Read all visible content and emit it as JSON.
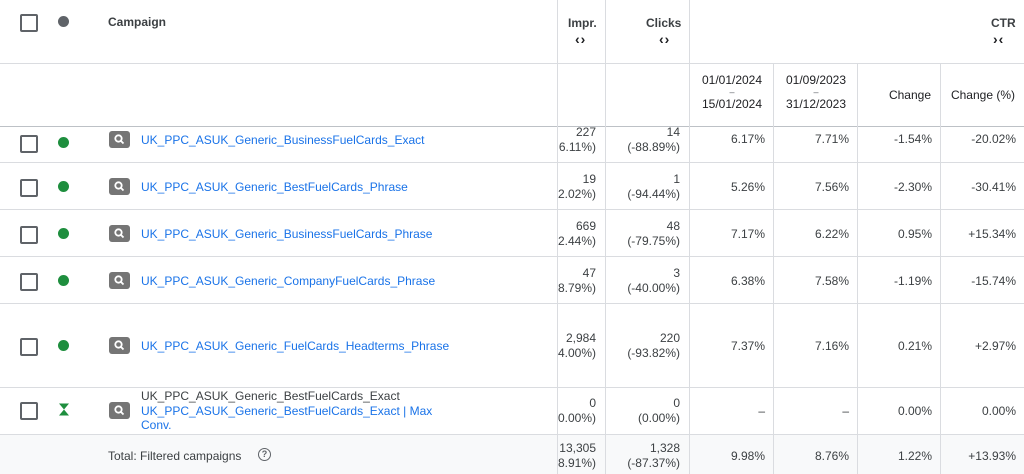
{
  "header": {
    "campaign": "Campaign",
    "impr": "Impr.",
    "clicks": "Clicks",
    "ctr": "CTR",
    "sort_icon": "‹›",
    "expand_icon": "›‹",
    "date_range_1": {
      "start": "01/01/2024",
      "dash": "–",
      "end": "15/01/2024"
    },
    "date_range_2": {
      "start": "01/09/2023",
      "dash": "–",
      "end": "31/12/2023"
    },
    "change": "Change",
    "change_pct": "Change (%)"
  },
  "colors": {
    "status_enabled": "#1e8e3e",
    "link": "#1a73e8",
    "icon_gray": "#757575"
  },
  "rows": [
    {
      "name": "UK_PPC_ASUK_Generic_BusinessFuelCards_Exact",
      "impr": "227",
      "impr_change": "6.11%)",
      "clicks": "14",
      "clicks_change": "(-88.89%)",
      "ctr1": "6.17%",
      "ctr2": "7.71%",
      "change": "-1.54%",
      "change_pct": "-20.02%"
    },
    {
      "name": "UK_PPC_ASUK_Generic_BestFuelCards_Phrase",
      "impr": "19",
      "impr_change": "2.02%)",
      "clicks": "1",
      "clicks_change": "(-94.44%)",
      "ctr1": "5.26%",
      "ctr2": "7.56%",
      "change": "-2.30%",
      "change_pct": "-30.41%"
    },
    {
      "name": "UK_PPC_ASUK_Generic_BusinessFuelCards_Phrase",
      "impr": "669",
      "impr_change": "2.44%)",
      "clicks": "48",
      "clicks_change": "(-79.75%)",
      "ctr1": "7.17%",
      "ctr2": "6.22%",
      "change": "0.95%",
      "change_pct": "+15.34%"
    },
    {
      "name": "UK_PPC_ASUK_Generic_CompanyFuelCards_Phrase",
      "impr": "47",
      "impr_change": "8.79%)",
      "clicks": "3",
      "clicks_change": "(-40.00%)",
      "ctr1": "6.38%",
      "ctr2": "7.58%",
      "change": "-1.19%",
      "change_pct": "-15.74%"
    },
    {
      "name": "UK_PPC_ASUK_Generic_FuelCards_Headterms_Phrase",
      "impr": "2,984",
      "impr_change": "4.00%)",
      "clicks": "220",
      "clicks_change": "(-93.82%)",
      "ctr1": "7.37%",
      "ctr2": "7.16%",
      "change": "0.21%",
      "change_pct": "+2.97%"
    },
    {
      "name_old": "UK_PPC_ASUK_Generic_BestFuelCards_Exact",
      "name_line1": "UK_PPC_ASUK_Generic_BestFuelCards_Exact | Max",
      "name_line2": "Conv.",
      "impr": "0",
      "impr_change": "0.00%)",
      "clicks": "0",
      "clicks_change": "(0.00%)",
      "ctr1": "–",
      "ctr2": "–",
      "change": "0.00%",
      "change_pct": "0.00%"
    }
  ],
  "total": {
    "label": "Total: Filtered campaigns",
    "help_icon": "?",
    "impr": "13,305",
    "impr_change": "8.91%)",
    "clicks": "1,328",
    "clicks_change": "(-87.37%)",
    "ctr1": "9.98%",
    "ctr2": "8.76%",
    "change": "1.22%",
    "change_pct": "+13.93%"
  }
}
